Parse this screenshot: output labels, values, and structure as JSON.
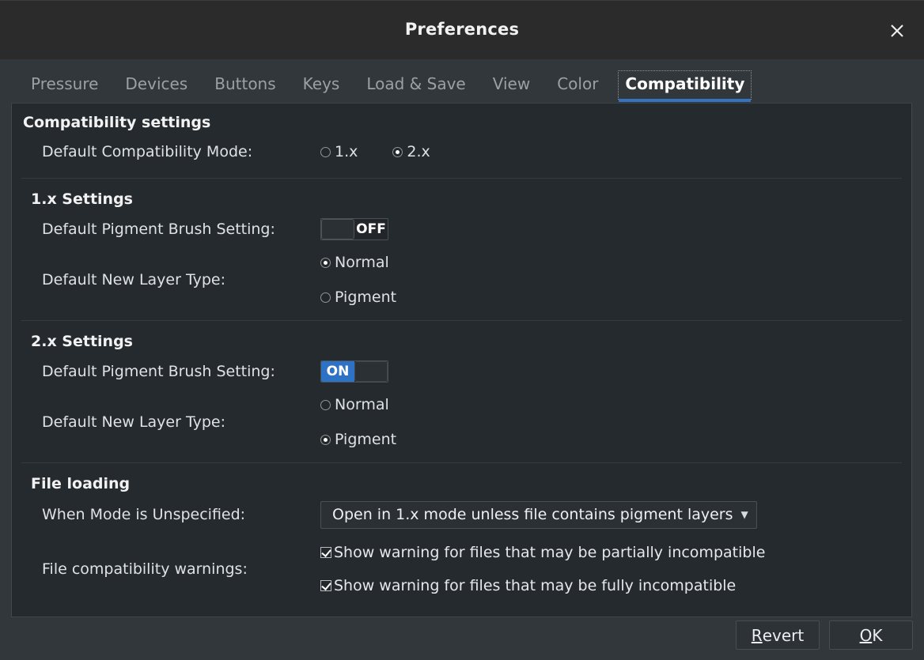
{
  "window": {
    "title": "Preferences",
    "close_icon": "close-icon",
    "accent_color": "#3573bd",
    "toggle_on_color": "#2d72c4"
  },
  "tabs": [
    {
      "label": "Pressure",
      "active": false
    },
    {
      "label": "Devices",
      "active": false
    },
    {
      "label": "Buttons",
      "active": false
    },
    {
      "label": "Keys",
      "active": false
    },
    {
      "label": "Load & Save",
      "active": false
    },
    {
      "label": "View",
      "active": false
    },
    {
      "label": "Color",
      "active": false
    },
    {
      "label": "Compatibility",
      "active": true
    }
  ],
  "sections": {
    "compatibility": {
      "title": "Compatibility settings",
      "mode_label": "Default Compatibility Mode:",
      "mode_options": [
        {
          "label": "1.x",
          "selected": false
        },
        {
          "label": "2.x",
          "selected": true
        }
      ]
    },
    "onex": {
      "title": "1.x Settings",
      "brush_label": "Default Pigment Brush Setting:",
      "brush_state": "OFF",
      "brush_on": false,
      "layer_label": "Default New Layer Type:",
      "layer_options": [
        {
          "label": "Normal",
          "selected": true
        },
        {
          "label": "Pigment",
          "selected": false
        }
      ]
    },
    "twox": {
      "title": "2.x Settings",
      "brush_label": "Default Pigment Brush Setting:",
      "brush_state": "ON",
      "brush_on": true,
      "layer_label": "Default New Layer Type:",
      "layer_options": [
        {
          "label": "Normal",
          "selected": false
        },
        {
          "label": "Pigment",
          "selected": true
        }
      ]
    },
    "fileloading": {
      "title": "File loading",
      "mode_label": "When Mode is Unspecified:",
      "mode_value": "Open in 1.x mode unless file contains pigment layers",
      "caret_icon": "chevron-down-icon",
      "warnings_label": "File compatibility warnings:",
      "warnings": [
        {
          "label": "Show warning for files that may be partially incompatible",
          "checked": true
        },
        {
          "label": "Show warning for files that may be fully incompatible",
          "checked": true
        }
      ]
    }
  },
  "footer": {
    "revert": {
      "mnemonic": "R",
      "rest": "evert"
    },
    "ok": {
      "mnemonic": "O",
      "rest": "K"
    }
  }
}
